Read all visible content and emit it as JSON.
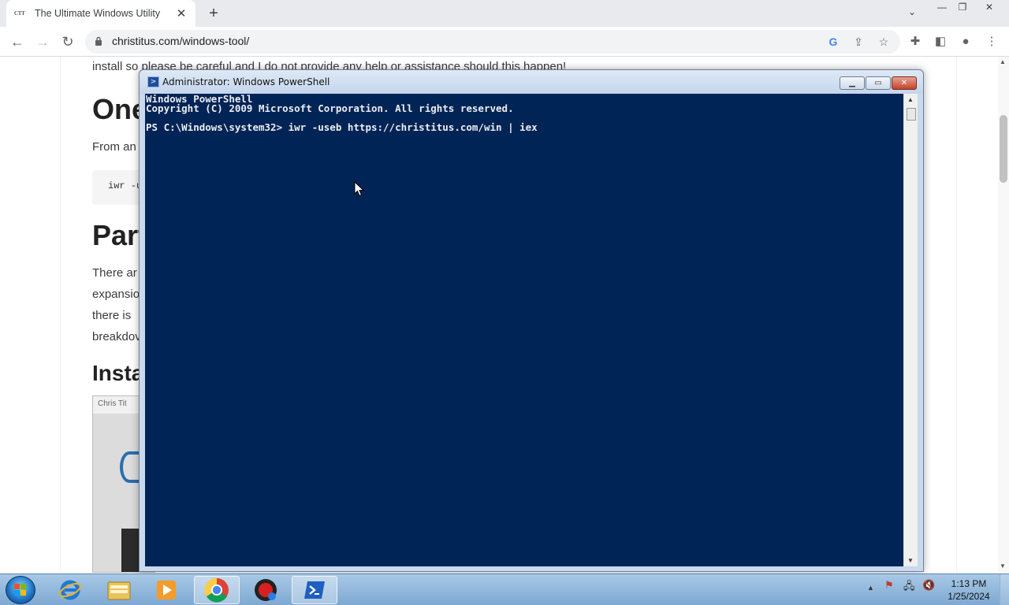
{
  "browser": {
    "tab_title": "The Ultimate Windows Utility",
    "favicon_text": "CTT",
    "url": "christitus.com/windows-tool/"
  },
  "page": {
    "partial_line": "install so please be careful and I do not provide any help or assistance should this happen!",
    "heading_one": "One",
    "from_text": "From an",
    "code_snippet": "iwr -u",
    "heading_part": "Part",
    "para_lines": [
      "There ar",
      "expansio",
      "there is",
      "breakdov"
    ],
    "heading_install": "Insta",
    "embed_title": "Chris Tit"
  },
  "powershell": {
    "window_title": "Administrator: Windows PowerShell",
    "lines": [
      "Windows PowerShell",
      "Copyright (C) 2009 Microsoft Corporation. All rights reserved.",
      "",
      "PS C:\\Windows\\system32> iwr -useb https://christitus.com/win | iex"
    ]
  },
  "taskbar": {
    "apps": [
      "start-button",
      "internet-explorer",
      "file-explorer",
      "media-player",
      "chrome",
      "screen-recorder",
      "powershell"
    ],
    "active_app": "powershell",
    "clock_time": "1:13 PM",
    "clock_date": "1/25/2024"
  },
  "colors": {
    "ps_console_bg": "#012456",
    "ps_console_fg": "#eeedf0",
    "taskbar": "#8fb6dc"
  }
}
